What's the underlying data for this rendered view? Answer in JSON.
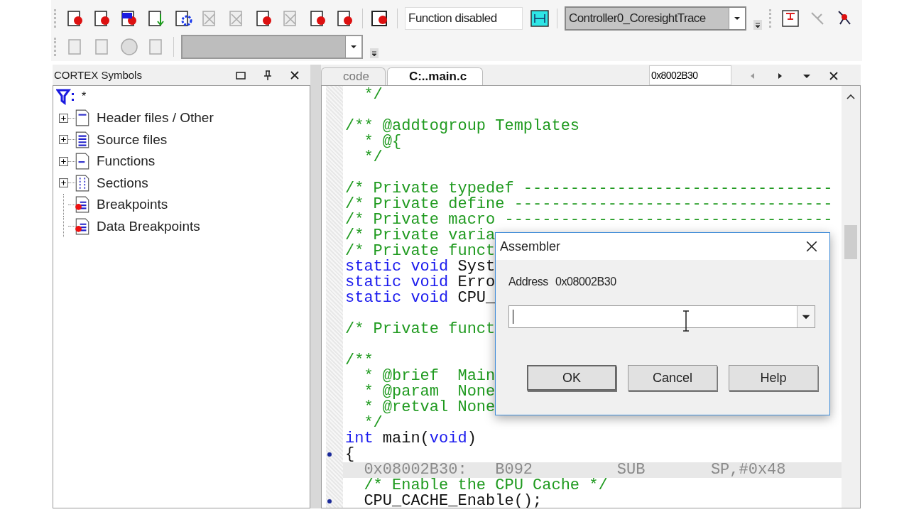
{
  "toolbar": {
    "function_field": {
      "value": "Function disabled"
    },
    "target_select": {
      "value": "Controller0_CoresightTrace"
    }
  },
  "symbols_panel": {
    "title": "CORTEX Symbols",
    "filter": "*",
    "tree": [
      {
        "label": "Header files / Other",
        "kind": "header"
      },
      {
        "label": "Source files",
        "kind": "source"
      },
      {
        "label": "Functions",
        "kind": "functions"
      },
      {
        "label": "Sections",
        "kind": "sections"
      },
      {
        "label": "Breakpoints",
        "kind": "breakpoints"
      },
      {
        "label": "Data Breakpoints",
        "kind": "breakpoints"
      }
    ]
  },
  "editor": {
    "tabs": [
      {
        "label": "code",
        "selected": false
      },
      {
        "label": "C:..main.c",
        "selected": true
      }
    ],
    "address_field": {
      "value": "0x8002B30"
    },
    "lines": [
      {
        "kind": "code",
        "marked": false,
        "segs": [
          {
            "kind": "comment",
            "text": "  */"
          }
        ]
      },
      {
        "kind": "blank",
        "marked": false
      },
      {
        "kind": "code",
        "marked": false,
        "segs": [
          {
            "kind": "comment",
            "text": "/** @addtogroup Templates"
          }
        ]
      },
      {
        "kind": "code",
        "marked": false,
        "segs": [
          {
            "kind": "comment",
            "text": "  * @{"
          }
        ]
      },
      {
        "kind": "code",
        "marked": false,
        "segs": [
          {
            "kind": "comment",
            "text": "  */"
          }
        ]
      },
      {
        "kind": "blank",
        "marked": false
      },
      {
        "kind": "code",
        "marked": false,
        "segs": [
          {
            "kind": "comment",
            "text": "/* Private typedef ---------------------------------"
          }
        ]
      },
      {
        "kind": "code",
        "marked": false,
        "segs": [
          {
            "kind": "comment",
            "text": "/* Private define ----------------------------------"
          }
        ]
      },
      {
        "kind": "code",
        "marked": false,
        "segs": [
          {
            "kind": "comment",
            "text": "/* Private macro -----------------------------------"
          }
        ]
      },
      {
        "kind": "code",
        "marked": false,
        "segs": [
          {
            "kind": "comment",
            "text": "/* Private varia"
          }
        ]
      },
      {
        "kind": "code",
        "marked": false,
        "segs": [
          {
            "kind": "comment",
            "text": "/* Private funct"
          }
        ]
      },
      {
        "kind": "code",
        "marked": false,
        "segs": [
          {
            "kind": "keyword",
            "text": "static void"
          },
          {
            "kind": "plain",
            "text": " Syst"
          }
        ]
      },
      {
        "kind": "code",
        "marked": false,
        "segs": [
          {
            "kind": "keyword",
            "text": "static void"
          },
          {
            "kind": "plain",
            "text": " Erro"
          }
        ]
      },
      {
        "kind": "code",
        "marked": false,
        "segs": [
          {
            "kind": "keyword",
            "text": "static void"
          },
          {
            "kind": "plain",
            "text": " CPU_"
          }
        ]
      },
      {
        "kind": "blank",
        "marked": false
      },
      {
        "kind": "code",
        "marked": false,
        "segs": [
          {
            "kind": "comment",
            "text": "/* Private funct"
          }
        ]
      },
      {
        "kind": "blank",
        "marked": false
      },
      {
        "kind": "code",
        "marked": false,
        "segs": [
          {
            "kind": "comment",
            "text": "/**"
          }
        ]
      },
      {
        "kind": "code",
        "marked": false,
        "segs": [
          {
            "kind": "comment",
            "text": "  * @brief  Main"
          }
        ]
      },
      {
        "kind": "code",
        "marked": false,
        "segs": [
          {
            "kind": "comment",
            "text": "  * @param  None"
          }
        ]
      },
      {
        "kind": "code",
        "marked": false,
        "segs": [
          {
            "kind": "comment",
            "text": "  * @retval None"
          }
        ]
      },
      {
        "kind": "code",
        "marked": false,
        "segs": [
          {
            "kind": "comment",
            "text": "  */"
          }
        ]
      },
      {
        "kind": "code",
        "marked": false,
        "segs": [
          {
            "kind": "keyword",
            "text": "int"
          },
          {
            "kind": "plain",
            "text": " main("
          },
          {
            "kind": "keyword",
            "text": "void"
          },
          {
            "kind": "plain",
            "text": ")"
          }
        ]
      },
      {
        "kind": "code",
        "marked": true,
        "segs": [
          {
            "kind": "plain",
            "text": "{"
          }
        ]
      },
      {
        "kind": "disasm",
        "marked": false,
        "segs": [
          {
            "kind": "disasm",
            "text": "  0x08002B30:   B092         SUB       SP,#0x48"
          }
        ]
      },
      {
        "kind": "code",
        "marked": false,
        "segs": [
          {
            "kind": "comment",
            "text": "  /* Enable the CPU Cache */"
          }
        ]
      },
      {
        "kind": "code",
        "marked": true,
        "segs": [
          {
            "kind": "plain",
            "text": "  CPU_CACHE_Enable();"
          }
        ]
      }
    ]
  },
  "dialog": {
    "title": "Assembler",
    "address_label": "Address",
    "address": "0x08002B30",
    "buttons": [
      "OK",
      "Cancel",
      "Help"
    ]
  }
}
